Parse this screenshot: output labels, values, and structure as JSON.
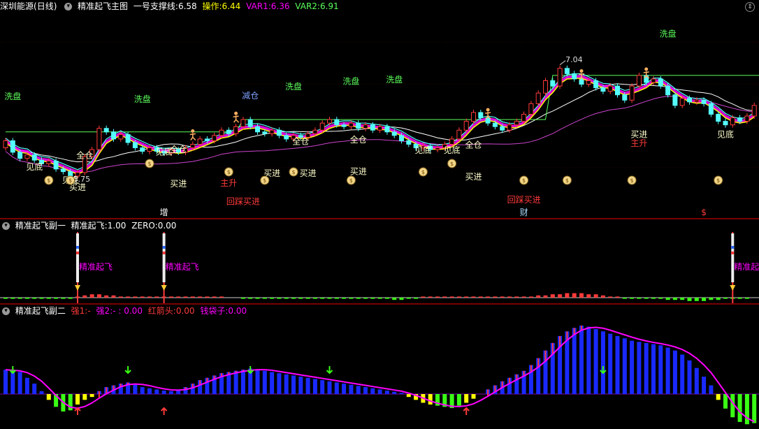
{
  "main_header": {
    "stock_name": "深圳能源",
    "period": "(日线)",
    "indicator": "精准起飞主图",
    "support_label": "一号支撑线:",
    "support_value": "6.58",
    "op_label": "操作:",
    "op_value": "6.44",
    "var1_label": "VAR1:",
    "var1_value": "6.36",
    "var2_label": "VAR2:",
    "var2_value": "6.91"
  },
  "sub1_header": {
    "indicator": "精准起飞副一",
    "line_label": "精准起飞:",
    "line_value": "1.00",
    "zero_label": "ZERO:",
    "zero_value": "0.00"
  },
  "sub2_header": {
    "indicator": "精准起飞副二",
    "s1_label": "强1:",
    "s1_value": "-",
    "s2_label": "强2:",
    "s2_value": "-",
    "s2_num": "0.00",
    "red_label": "红箭头:",
    "red_value": "0.00",
    "bag_label": "钱袋子:",
    "bag_value": "0.00"
  },
  "colors": {
    "up": "#ff3a3a",
    "down": "#54fcfc",
    "pink": "#ff00ff",
    "yellow": "#ffff00",
    "green_label": "#5cff5c",
    "white": "#ffffff",
    "magenta_line": "#cc44cc",
    "blue_bar": "#1a2aff",
    "lime": "#39ff14"
  },
  "icons": {
    "money_bag": "money-bag-icon",
    "runner": "runner-icon",
    "rocket": "rocket-icon"
  },
  "chart_data": [
    {
      "type": "candlestick",
      "title": "精准起飞主图",
      "price_max_label": "7.04",
      "price_min_label": "5.75",
      "ylim": [
        5.4,
        7.6
      ],
      "candles": [
        {
          "o": 6.1,
          "c": 6.18
        },
        {
          "o": 6.18,
          "c": 6.05
        },
        {
          "o": 6.05,
          "c": 5.98
        },
        {
          "o": 5.98,
          "c": 6.02
        },
        {
          "o": 6.02,
          "c": 5.96
        },
        {
          "o": 5.96,
          "c": 5.92
        },
        {
          "o": 5.92,
          "c": 5.95
        },
        {
          "o": 5.95,
          "c": 5.86
        },
        {
          "o": 5.86,
          "c": 5.83
        },
        {
          "o": 5.83,
          "c": 5.78
        },
        {
          "o": 5.78,
          "c": 5.82
        },
        {
          "o": 5.82,
          "c": 6.0
        },
        {
          "o": 6.0,
          "c": 6.08
        },
        {
          "o": 6.08,
          "c": 6.32
        },
        {
          "o": 6.32,
          "c": 6.28
        },
        {
          "o": 6.28,
          "c": 6.2
        },
        {
          "o": 6.2,
          "c": 6.25
        },
        {
          "o": 6.25,
          "c": 6.16
        },
        {
          "o": 6.16,
          "c": 6.1
        },
        {
          "o": 6.1,
          "c": 6.06
        },
        {
          "o": 6.06,
          "c": 6.1
        },
        {
          "o": 6.1,
          "c": 6.06
        },
        {
          "o": 6.06,
          "c": 6.04
        },
        {
          "o": 6.04,
          "c": 6.08
        },
        {
          "o": 6.08,
          "c": 6.05
        },
        {
          "o": 6.05,
          "c": 6.1
        },
        {
          "o": 6.1,
          "c": 6.14
        },
        {
          "o": 6.14,
          "c": 6.2
        },
        {
          "o": 6.2,
          "c": 6.18
        },
        {
          "o": 6.18,
          "c": 6.24
        },
        {
          "o": 6.24,
          "c": 6.3
        },
        {
          "o": 6.3,
          "c": 6.26
        },
        {
          "o": 6.26,
          "c": 6.34
        },
        {
          "o": 6.34,
          "c": 6.42
        },
        {
          "o": 6.42,
          "c": 6.34
        },
        {
          "o": 6.34,
          "c": 6.28
        },
        {
          "o": 6.28,
          "c": 6.26
        },
        {
          "o": 6.26,
          "c": 6.3
        },
        {
          "o": 6.3,
          "c": 6.24
        },
        {
          "o": 6.24,
          "c": 6.2
        },
        {
          "o": 6.2,
          "c": 6.24
        },
        {
          "o": 6.24,
          "c": 6.22
        },
        {
          "o": 6.22,
          "c": 6.26
        },
        {
          "o": 6.26,
          "c": 6.3
        },
        {
          "o": 6.3,
          "c": 6.38
        },
        {
          "o": 6.38,
          "c": 6.42
        },
        {
          "o": 6.42,
          "c": 6.36
        },
        {
          "o": 6.36,
          "c": 6.34
        },
        {
          "o": 6.34,
          "c": 6.38
        },
        {
          "o": 6.38,
          "c": 6.32
        },
        {
          "o": 6.32,
          "c": 6.36
        },
        {
          "o": 6.36,
          "c": 6.3
        },
        {
          "o": 6.3,
          "c": 6.34
        },
        {
          "o": 6.34,
          "c": 6.28
        },
        {
          "o": 6.28,
          "c": 6.24
        },
        {
          "o": 6.24,
          "c": 6.18
        },
        {
          "o": 6.18,
          "c": 6.14
        },
        {
          "o": 6.14,
          "c": 6.1
        },
        {
          "o": 6.1,
          "c": 6.12
        },
        {
          "o": 6.12,
          "c": 6.08
        },
        {
          "o": 6.08,
          "c": 6.1
        },
        {
          "o": 6.1,
          "c": 6.14
        },
        {
          "o": 6.14,
          "c": 6.2
        },
        {
          "o": 6.2,
          "c": 6.3
        },
        {
          "o": 6.3,
          "c": 6.4
        },
        {
          "o": 6.4,
          "c": 6.5
        },
        {
          "o": 6.5,
          "c": 6.44
        },
        {
          "o": 6.44,
          "c": 6.38
        },
        {
          "o": 6.38,
          "c": 6.34
        },
        {
          "o": 6.34,
          "c": 6.3
        },
        {
          "o": 6.3,
          "c": 6.36
        },
        {
          "o": 6.36,
          "c": 6.4
        },
        {
          "o": 6.4,
          "c": 6.48
        },
        {
          "o": 6.48,
          "c": 6.6
        },
        {
          "o": 6.6,
          "c": 6.72
        },
        {
          "o": 6.72,
          "c": 6.86
        },
        {
          "o": 6.86,
          "c": 6.8
        },
        {
          "o": 6.8,
          "c": 7.0
        },
        {
          "o": 7.0,
          "c": 6.94
        },
        {
          "o": 6.94,
          "c": 6.88
        },
        {
          "o": 6.88,
          "c": 6.82
        },
        {
          "o": 6.82,
          "c": 6.86
        },
        {
          "o": 6.86,
          "c": 6.78
        },
        {
          "o": 6.78,
          "c": 6.74
        },
        {
          "o": 6.74,
          "c": 6.8
        },
        {
          "o": 6.8,
          "c": 6.7
        },
        {
          "o": 6.7,
          "c": 6.64
        },
        {
          "o": 6.64,
          "c": 6.8
        },
        {
          "o": 6.8,
          "c": 6.92
        },
        {
          "o": 6.92,
          "c": 6.84
        },
        {
          "o": 6.84,
          "c": 6.88
        },
        {
          "o": 6.88,
          "c": 6.8
        },
        {
          "o": 6.8,
          "c": 6.7
        },
        {
          "o": 6.7,
          "c": 6.58
        },
        {
          "o": 6.58,
          "c": 6.66
        },
        {
          "o": 6.66,
          "c": 6.62
        },
        {
          "o": 6.62,
          "c": 6.64
        },
        {
          "o": 6.64,
          "c": 6.6
        },
        {
          "o": 6.6,
          "c": 6.48
        },
        {
          "o": 6.48,
          "c": 6.4
        },
        {
          "o": 6.4,
          "c": 6.36
        },
        {
          "o": 6.36,
          "c": 6.44
        },
        {
          "o": 6.44,
          "c": 6.4
        },
        {
          "o": 6.4,
          "c": 6.46
        },
        {
          "o": 6.46,
          "c": 6.58
        }
      ],
      "support_line": [
        6.28,
        6.28,
        6.28,
        6.28,
        6.28,
        6.28,
        6.28,
        6.28,
        6.28,
        6.28,
        6.28,
        6.28,
        6.28,
        6.28,
        6.28,
        6.28,
        6.28,
        6.28,
        6.28,
        6.28,
        6.28,
        6.28,
        6.28,
        6.28,
        6.28,
        6.28,
        6.28,
        6.28,
        6.28,
        6.28,
        6.28,
        6.28,
        6.28,
        6.42,
        6.42,
        6.42,
        6.42,
        6.42,
        6.42,
        6.42,
        6.42,
        6.42,
        6.42,
        6.42,
        6.42,
        6.42,
        6.42,
        6.42,
        6.42,
        6.42,
        6.42,
        6.42,
        6.42,
        6.42,
        6.42,
        6.42,
        6.42,
        6.42,
        6.42,
        6.42,
        6.42,
        6.42,
        6.42,
        6.42,
        6.42,
        6.42,
        6.42,
        6.42,
        6.42,
        6.42,
        6.42,
        6.42,
        6.42,
        6.42,
        6.42,
        6.42,
        6.92,
        6.92,
        6.92,
        6.92,
        6.92,
        6.92,
        6.92,
        6.92,
        6.92,
        6.92,
        6.92,
        6.92,
        6.92,
        6.92,
        6.92,
        6.92,
        6.92,
        6.92,
        6.92,
        6.92,
        6.92,
        6.92,
        6.92,
        6.92,
        6.92,
        6.92,
        6.92,
        6.92,
        6.92,
        6.92
      ],
      "labels": [
        {
          "i": 1,
          "p": 6.65,
          "text": "洗盘",
          "color": "#5cff5c"
        },
        {
          "i": 4,
          "p": 5.85,
          "text": "见底",
          "color": "#ffffcc"
        },
        {
          "i": 9,
          "p": 5.7,
          "text": "见底",
          "color": "#ffffcc"
        },
        {
          "i": 10,
          "p": 5.62,
          "text": "买进",
          "color": "#ffffcc"
        },
        {
          "i": 11,
          "p": 5.98,
          "text": "全仓",
          "color": "#ffffcc"
        },
        {
          "i": 19,
          "p": 6.62,
          "text": "洗盘",
          "color": "#5cff5c"
        },
        {
          "i": 22,
          "p": 6.02,
          "text": "见底",
          "color": "#ffffcc"
        },
        {
          "i": 24,
          "p": 6.05,
          "text": "全仓",
          "color": "#ffffcc"
        },
        {
          "i": 24,
          "p": 5.66,
          "text": "买进",
          "color": "#ffffcc"
        },
        {
          "i": 31,
          "p": 5.67,
          "text": "主升",
          "color": "#ff3a3a"
        },
        {
          "i": 33,
          "p": 5.46,
          "text": "回踩买进",
          "color": "#ff3a3a"
        },
        {
          "i": 34,
          "p": 6.66,
          "text": "减仓",
          "color": "#7fa0ff"
        },
        {
          "i": 37,
          "p": 5.78,
          "text": "买进",
          "color": "#ffffcc"
        },
        {
          "i": 40,
          "p": 6.76,
          "text": "洗盘",
          "color": "#5cff5c"
        },
        {
          "i": 41,
          "p": 6.14,
          "text": "全仓",
          "color": "#ffffcc"
        },
        {
          "i": 42,
          "p": 5.78,
          "text": "买进",
          "color": "#ffffcc"
        },
        {
          "i": 48,
          "p": 6.82,
          "text": "洗盘",
          "color": "#5cff5c"
        },
        {
          "i": 49,
          "p": 6.16,
          "text": "全仓",
          "color": "#ffffcc"
        },
        {
          "i": 49,
          "p": 5.8,
          "text": "买进",
          "color": "#ffffcc"
        },
        {
          "i": 54,
          "p": 6.84,
          "text": "洗盘",
          "color": "#5cff5c"
        },
        {
          "i": 58,
          "p": 6.04,
          "text": "见底",
          "color": "#ffffcc"
        },
        {
          "i": 62,
          "p": 6.04,
          "text": "见底",
          "color": "#ffffcc"
        },
        {
          "i": 65,
          "p": 6.1,
          "text": "全仓",
          "color": "#ffffcc"
        },
        {
          "i": 65,
          "p": 5.74,
          "text": "买进",
          "color": "#ffffcc"
        },
        {
          "i": 72,
          "p": 5.48,
          "text": "回踩买进",
          "color": "#ff3a3a"
        },
        {
          "i": 92,
          "p": 7.36,
          "text": "洗盘",
          "color": "#5cff5c"
        },
        {
          "i": 88,
          "p": 6.22,
          "text": "买进",
          "color": "#ffffcc"
        },
        {
          "i": 88,
          "p": 6.12,
          "text": "主升",
          "color": "#ff3a3a"
        },
        {
          "i": 100,
          "p": 6.22,
          "text": "见底",
          "color": "#ffffcc"
        }
      ],
      "money_bags": [
        6,
        9,
        20,
        31,
        36,
        40,
        48,
        58,
        62,
        72,
        78,
        87,
        99
      ],
      "runners": [
        26,
        32,
        67,
        80,
        89
      ],
      "bottom_marks": [
        {
          "i": 22,
          "text": "增",
          "color": "#ffffff"
        },
        {
          "i": 72,
          "text": "财",
          "color": "#aaddff"
        },
        {
          "i": 97,
          "text": "$",
          "color": "#ff3a3a"
        }
      ]
    },
    {
      "type": "bar",
      "title": "精准起飞副一",
      "signal_label": "精准起飞",
      "signal_indices": [
        10,
        22,
        101
      ],
      "values": [
        -1,
        -1,
        -1,
        -1,
        -1,
        -1,
        -1,
        -1,
        -1,
        -1,
        1,
        2,
        3,
        3,
        2,
        2,
        1,
        1,
        1,
        1,
        1,
        1,
        1,
        1,
        1,
        1,
        1,
        1,
        1,
        1,
        1,
        0,
        0,
        -1,
        -1,
        -1,
        -1,
        -1,
        -1,
        -1,
        -1,
        -1,
        -1,
        -1,
        -1,
        -1,
        -1,
        -1,
        -1,
        -1,
        -1,
        -1,
        -1,
        -1,
        -2,
        -2,
        -1,
        -1,
        1,
        1,
        1,
        1,
        1,
        1,
        1,
        1,
        1,
        1,
        1,
        1,
        1,
        1,
        1,
        1,
        2,
        2,
        3,
        3,
        4,
        4,
        4,
        3,
        3,
        2,
        1,
        1,
        -1,
        -1,
        -1,
        -1,
        -1,
        -1,
        -2,
        -2,
        -2,
        -3,
        -3,
        -3,
        -2,
        -2,
        -1,
        -1,
        -1,
        -1
      ]
    },
    {
      "type": "bar",
      "title": "精准起飞副二",
      "ylim": [
        -60,
        130
      ],
      "values": [
        42,
        40,
        38,
        28,
        18,
        5,
        -10,
        -22,
        -30,
        -28,
        -18,
        -10,
        -5,
        5,
        12,
        15,
        18,
        20,
        16,
        12,
        10,
        8,
        6,
        5,
        8,
        12,
        18,
        24,
        28,
        32,
        36,
        38,
        40,
        42,
        44,
        42,
        40,
        38,
        36,
        34,
        32,
        30,
        28,
        26,
        24,
        22,
        20,
        18,
        16,
        14,
        12,
        10,
        8,
        6,
        4,
        2,
        -5,
        -10,
        -15,
        -18,
        -20,
        -22,
        -24,
        -20,
        -15,
        -8,
        0,
        8,
        15,
        22,
        28,
        34,
        40,
        50,
        62,
        75,
        88,
        100,
        108,
        114,
        118,
        116,
        112,
        108,
        104,
        100,
        96,
        92,
        90,
        88,
        86,
        84,
        80,
        75,
        68,
        58,
        45,
        30,
        15,
        -10,
        -25,
        -40,
        -48,
        -52,
        -50
      ]
    }
  ]
}
